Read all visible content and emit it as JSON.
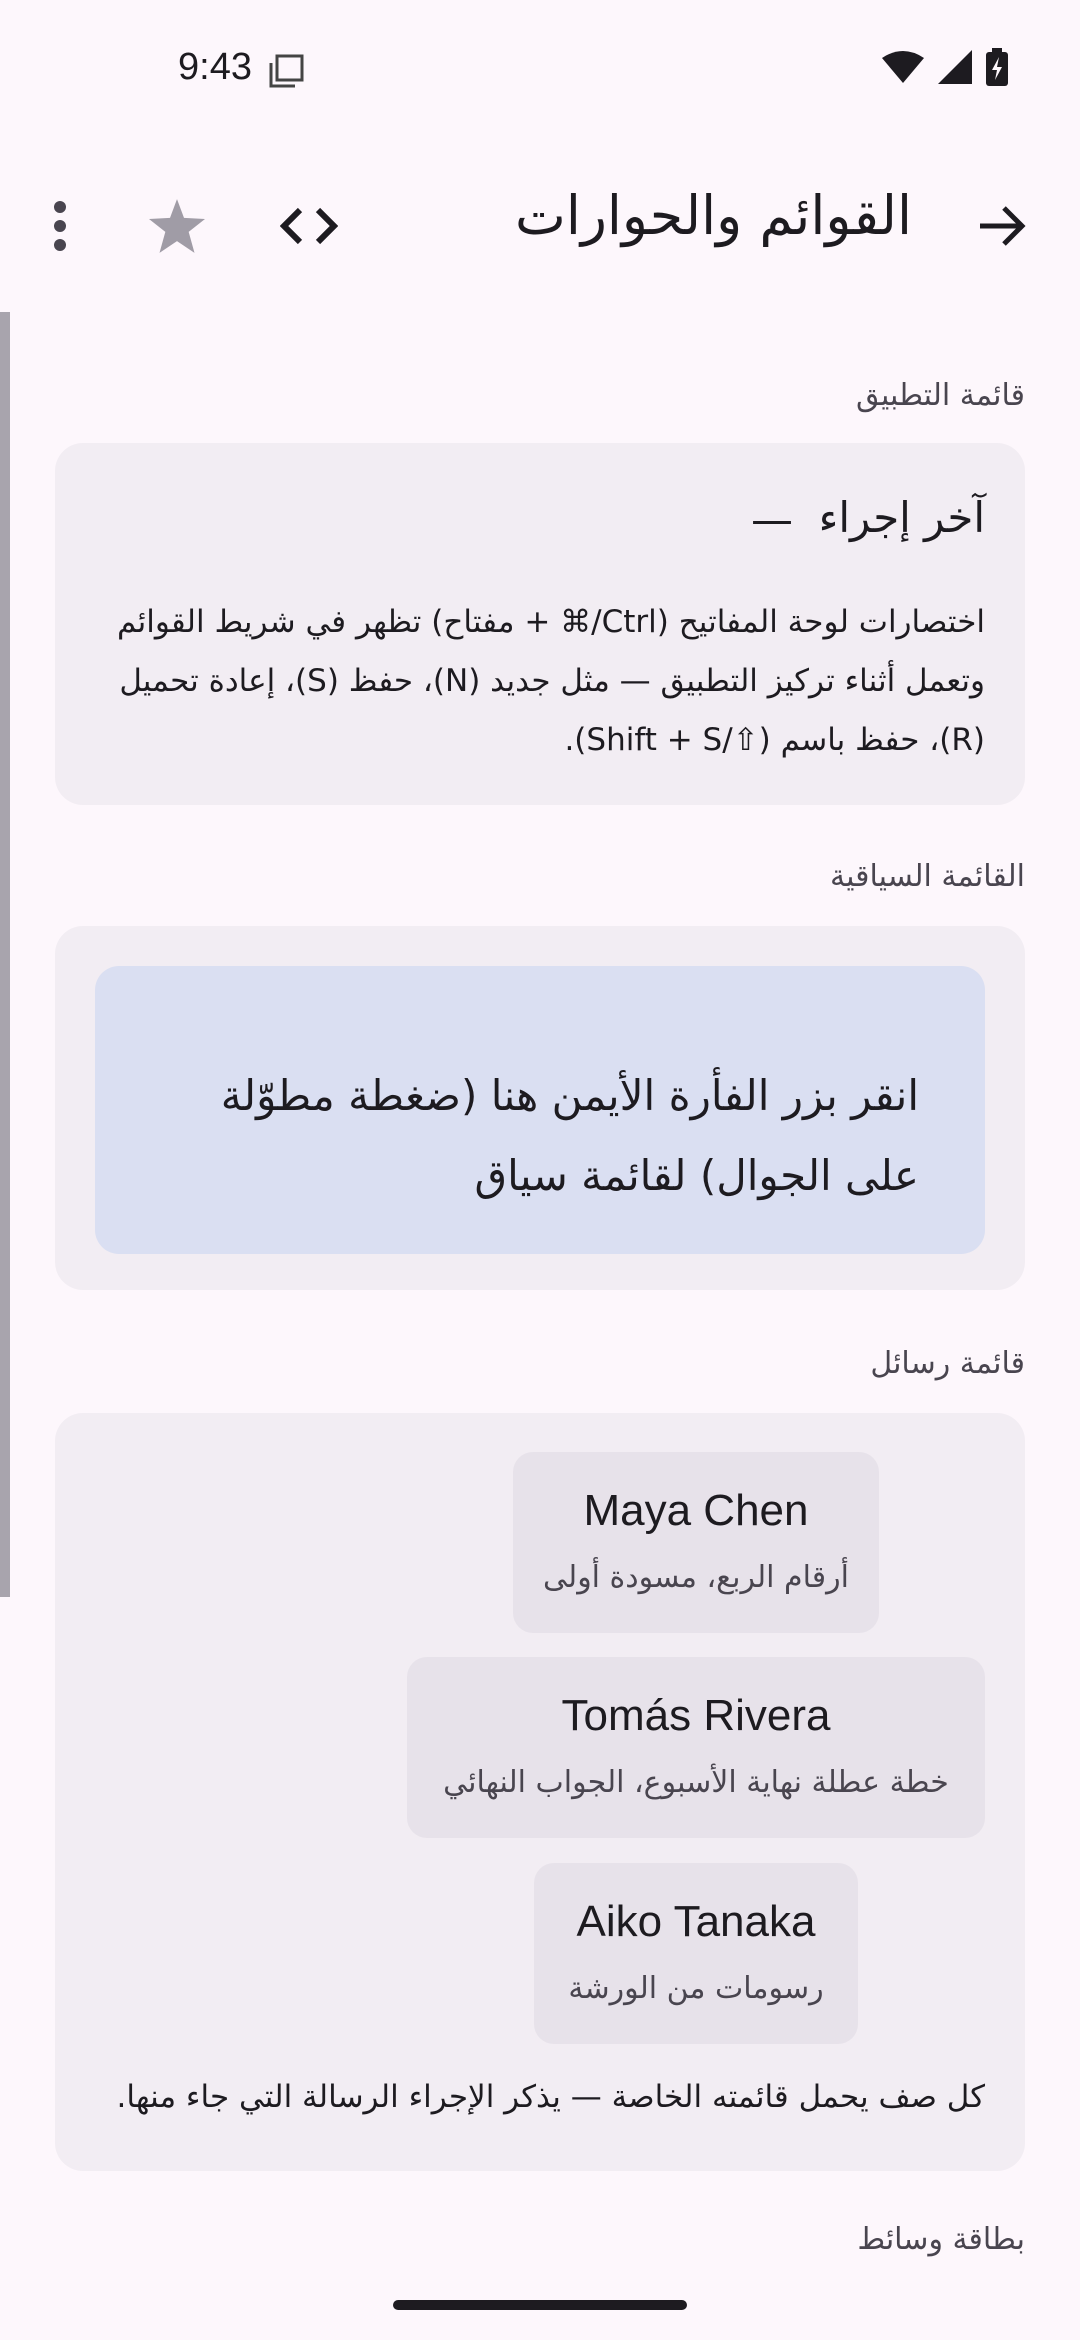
{
  "status": {
    "time": "9:43"
  },
  "app_bar": {
    "title": "القوائم والحوارات",
    "back_icon": "arrow-forward-icon",
    "code_icon": "code-icon",
    "star_icon": "star-icon",
    "more_icon": "more-vert-icon"
  },
  "app_menu": {
    "label": "قائمة التطبيق",
    "title": "آخر إجراء",
    "dash": "—",
    "description": "اختصارات لوحة المفاتيح (Ctrl/⌘ + مفتاح) تظهر في شريط القوائم وتعمل أثناء تركيز التطبيق — مثل جديد (N)، حفظ (S)، إعادة تحميل (R)، حفظ باسم (⇧/Shift + S)."
  },
  "context_menu": {
    "label": "القائمة السياقية",
    "target_text": "انقر بزر الفأرة الأيمن هنا (ضغطة مطوّلة على الجوال) لقائمة سياق"
  },
  "message_menu": {
    "label": "قائمة رسائل",
    "messages": [
      {
        "name": "Maya Chen",
        "preview": "أرقام الربع، مسودة أولى"
      },
      {
        "name": "Tomás Rivera",
        "preview": "خطة عطلة نهاية الأسبوع، الجواب النهائي"
      },
      {
        "name": "Aiko Tanaka",
        "preview": "رسومات من الورشة"
      }
    ],
    "footer": "كل صف يحمل قائمته الخاصة — يذكر الإجراء الرسالة التي جاء منها."
  },
  "media_card": {
    "label": "بطاقة وسائط"
  },
  "colors": {
    "background": "#fdf7fc",
    "card": "#f2edf3",
    "context_target": "#dadff2",
    "message_row": "#e7e2ea"
  }
}
